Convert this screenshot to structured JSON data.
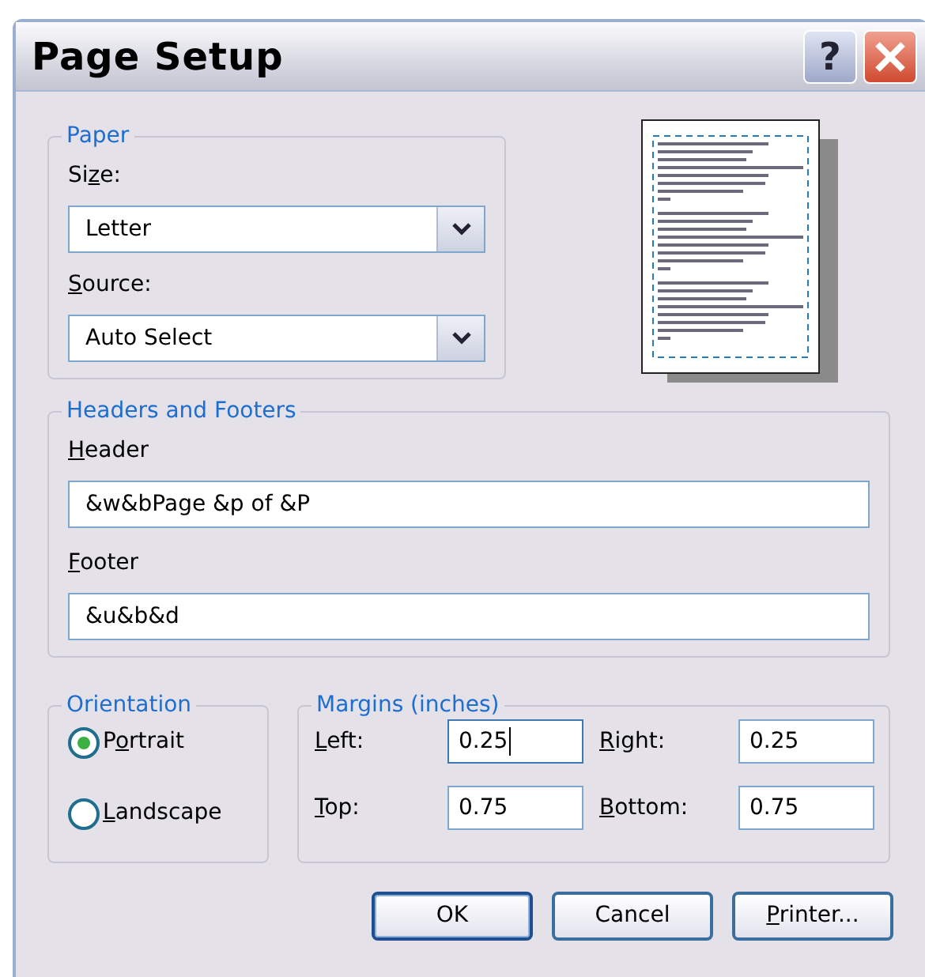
{
  "window": {
    "title": "Page Setup",
    "controls": [
      {
        "kind": "help",
        "label": "?"
      },
      {
        "kind": "close"
      }
    ]
  },
  "paper": {
    "legend": "Paper",
    "fields": [
      {
        "label": {
          "before": "Si",
          "key": "z",
          "after": "e:"
        },
        "value": "Letter"
      },
      {
        "label": {
          "key": "S",
          "after": "ource:"
        },
        "value": "Auto Select"
      }
    ]
  },
  "headers_footers": {
    "legend": "Headers and Footers",
    "fields": [
      {
        "label": {
          "key": "H",
          "after": "eader"
        },
        "value": "&w&bPage &p of &P"
      },
      {
        "label": {
          "key": "F",
          "after": "ooter"
        },
        "value": "&u&b&d"
      }
    ]
  },
  "orientation": {
    "legend": "Orientation",
    "options": [
      {
        "label": {
          "before": "P",
          "key": "o",
          "after": "rtrait"
        },
        "selected": true
      },
      {
        "label": {
          "key": "L",
          "after": "andscape"
        },
        "selected": false
      }
    ]
  },
  "margins": {
    "legend": "Margins (inches)",
    "fields": [
      {
        "label": {
          "key": "L",
          "after": "eft:"
        },
        "value": "0.25",
        "focused": true
      },
      {
        "label": {
          "key": "R",
          "after": "ight:"
        },
        "value": "0.25",
        "focused": false
      },
      {
        "label": {
          "key": "T",
          "after": "op:"
        },
        "value": "0.75",
        "focused": false
      },
      {
        "label": {
          "key": "B",
          "after": "ottom:"
        },
        "value": "0.75",
        "focused": false
      }
    ]
  },
  "buttons": [
    {
      "label": {
        "before": "OK"
      },
      "default": true
    },
    {
      "label": {
        "before": "Cancel"
      },
      "default": false
    },
    {
      "label": {
        "key": "P",
        "after": "rinter..."
      },
      "default": false
    }
  ]
}
